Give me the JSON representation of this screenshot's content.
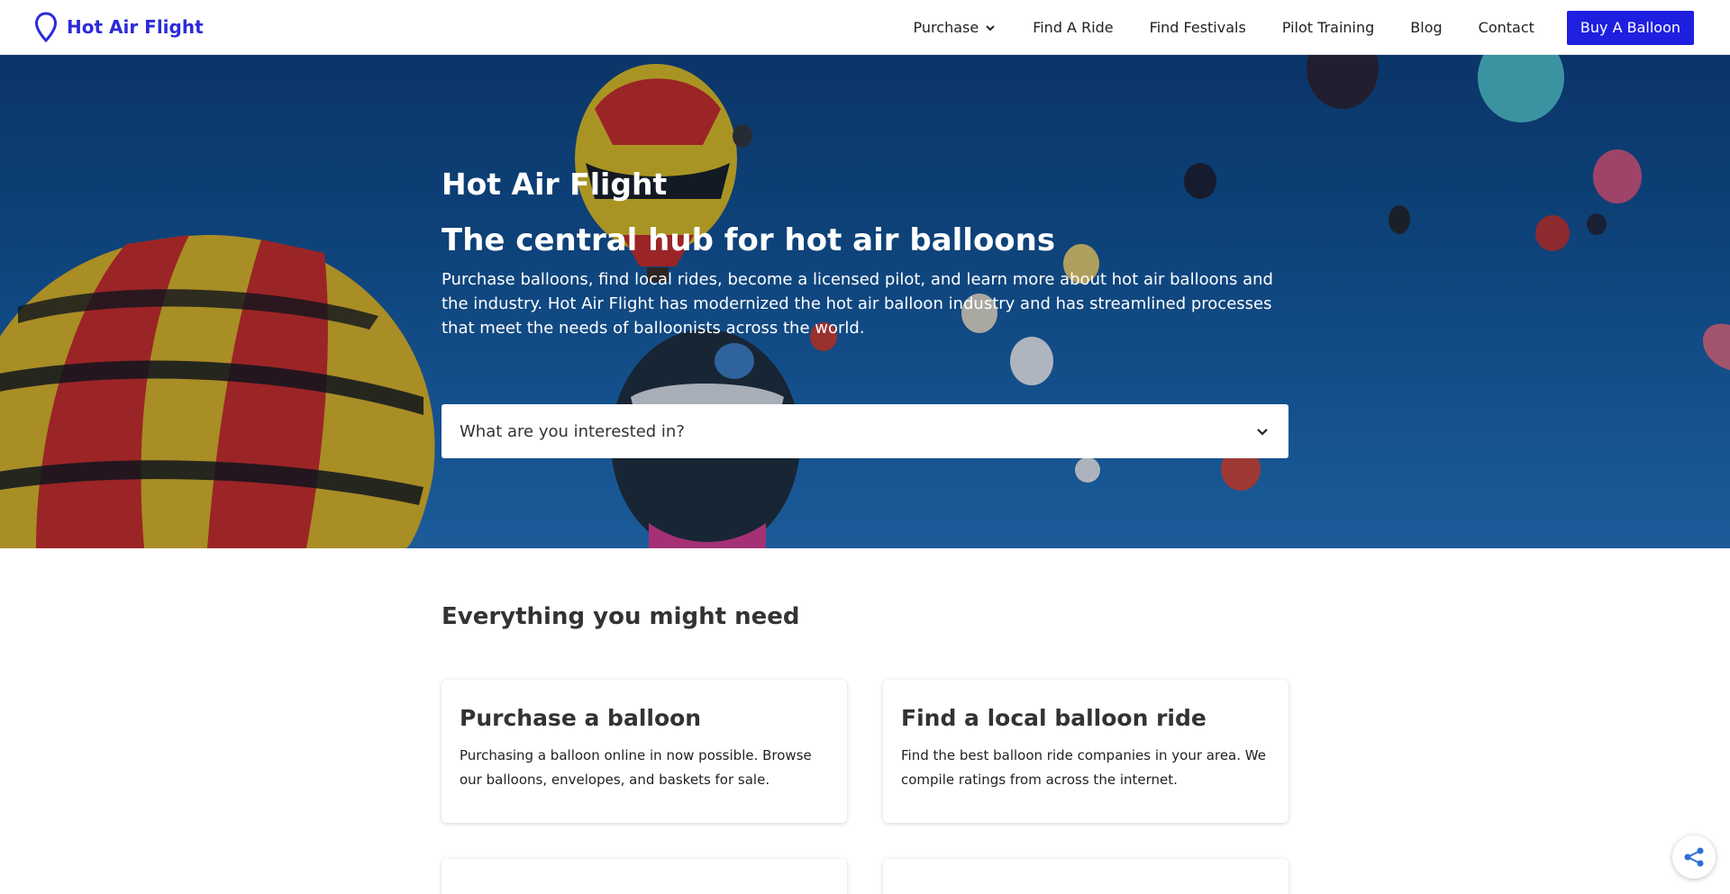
{
  "brand": {
    "name": "Hot Air Flight",
    "icon": "map-pin-icon",
    "color": "#2b2bd9"
  },
  "nav": {
    "items": [
      {
        "label": "Purchase",
        "has_dropdown": true
      },
      {
        "label": "Find A Ride"
      },
      {
        "label": "Find Festivals"
      },
      {
        "label": "Pilot Training"
      },
      {
        "label": "Blog"
      },
      {
        "label": "Contact"
      }
    ],
    "cta_label": "Buy A Balloon",
    "cta_color": "#1f1fe0"
  },
  "hero": {
    "title": "Hot Air Flight",
    "subtitle": "The central hub for hot air balloons",
    "description": "Purchase balloons, find local rides, become a licensed pilot, and learn more about hot air balloons and the industry. Hot Air Flight has modernized the hot air balloon industry and has streamlined processes that meet the needs of balloonists across the world.",
    "select_placeholder": "What are you interested in?"
  },
  "features": {
    "title": "Everything you might need",
    "cards": [
      {
        "title": "Purchase a balloon",
        "description": "Purchasing a balloon online in now possible. Browse our balloons, envelopes, and baskets for sale."
      },
      {
        "title": "Find a local balloon ride",
        "description": "Find the best balloon ride companies in your area. We compile ratings from across the internet."
      },
      {
        "title": "",
        "description": ""
      },
      {
        "title": "",
        "description": ""
      }
    ]
  },
  "floating": {
    "icon": "share-icon"
  }
}
